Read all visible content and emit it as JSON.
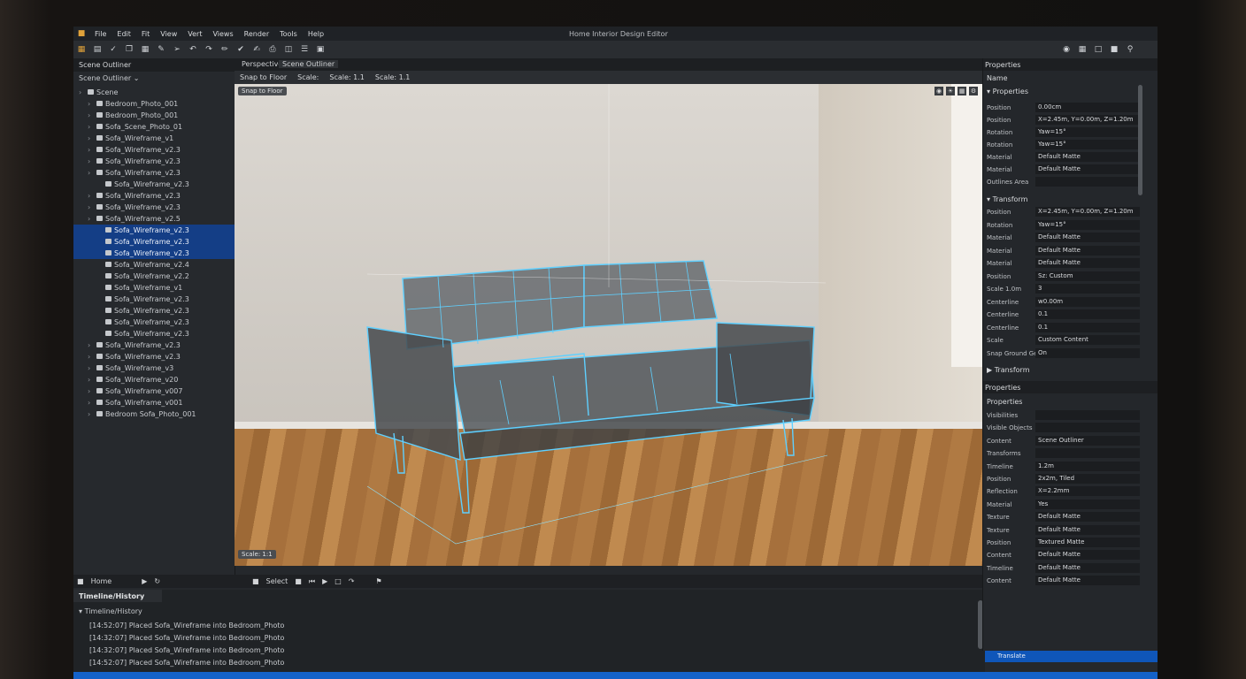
{
  "window": {
    "title": "Home Interior Design Editor"
  },
  "menubar": [
    "File",
    "Edit",
    "Fit",
    "View",
    "Vert",
    "Views",
    "Render",
    "Tools",
    "Help"
  ],
  "outliner": {
    "tab": "Scene Outliner",
    "header": "Scene Outliner",
    "items": [
      {
        "label": "Scene",
        "sel": false,
        "indent": 0
      },
      {
        "label": "Bedroom_Photo_001",
        "sel": false,
        "indent": 1
      },
      {
        "label": "Bedroom_Photo_001",
        "sel": false,
        "indent": 1
      },
      {
        "label": "Sofa_Scene_Photo_01",
        "sel": false,
        "indent": 1
      },
      {
        "label": "Sofa_Wireframe_v1",
        "sel": false,
        "indent": 1
      },
      {
        "label": "Sofa_Wireframe_v2.3",
        "sel": false,
        "indent": 1
      },
      {
        "label": "Sofa_Wireframe_v2.3",
        "sel": false,
        "indent": 1
      },
      {
        "label": "Sofa_Wireframe_v2.3",
        "sel": false,
        "indent": 1
      },
      {
        "label": "Sofa_Wireframe_v2.3",
        "sel": false,
        "indent": 2
      },
      {
        "label": "Sofa_Wireframe_v2.3",
        "sel": false,
        "indent": 1
      },
      {
        "label": "Sofa_Wireframe_v2.3",
        "sel": false,
        "indent": 1
      },
      {
        "label": "Sofa_Wireframe_v2.5",
        "sel": false,
        "indent": 1
      },
      {
        "label": "Sofa_Wireframe_v2.3",
        "sel": true,
        "indent": 2
      },
      {
        "label": "Sofa_Wireframe_v2.3",
        "sel": true,
        "indent": 2
      },
      {
        "label": "Sofa_Wireframe_v2.3",
        "sel": true,
        "indent": 2
      },
      {
        "label": "Sofa_Wireframe_v2.4",
        "sel": false,
        "indent": 2
      },
      {
        "label": "Sofa_Wireframe_v2.2",
        "sel": false,
        "indent": 2
      },
      {
        "label": "Sofa_Wireframe_v1",
        "sel": false,
        "indent": 2
      },
      {
        "label": "Sofa_Wireframe_v2.3",
        "sel": false,
        "indent": 2
      },
      {
        "label": "Sofa_Wireframe_v2.3",
        "sel": false,
        "indent": 2
      },
      {
        "label": "Sofa_Wireframe_v2.3",
        "sel": false,
        "indent": 2
      },
      {
        "label": "Sofa_Wireframe_v2.3",
        "sel": false,
        "indent": 2
      },
      {
        "label": "Sofa_Wireframe_v2.3",
        "sel": false,
        "indent": 1
      },
      {
        "label": "Sofa_Wireframe_v2.3",
        "sel": false,
        "indent": 1
      },
      {
        "label": "Sofa_Wireframe_v3",
        "sel": false,
        "indent": 1
      },
      {
        "label": "Sofa_Wireframe_v20",
        "sel": false,
        "indent": 1
      },
      {
        "label": "Sofa_Wireframe_v007",
        "sel": false,
        "indent": 1
      },
      {
        "label": "Sofa_Wireframe_v001",
        "sel": false,
        "indent": 1
      },
      {
        "label": "Bedroom Sofa_Photo_001",
        "sel": false,
        "indent": 1
      }
    ]
  },
  "viewport": {
    "tabs": [
      "Perspective",
      "Scene Outliner"
    ],
    "bar": [
      "Snap to Floor",
      "Scale:",
      "Scale: 1.1",
      "Scale: 1.1"
    ],
    "chip_top": "Snap to Floor",
    "chip_bottom": "Scale: 1:1"
  },
  "bottom_strip": {
    "left": "Home",
    "mid": "Select"
  },
  "timeline": {
    "tab": "Timeline/History",
    "header": "Timeline/History",
    "lines": [
      "[14:52:07] Placed Sofa_Wireframe into Bedroom_Photo",
      "[14:32:07] Placed Sofa_Wireframe into Bedroom_Photo",
      "[14:32:07] Placed Sofa_Wireframe into Bedroom_Photo",
      "[14:52:07] Placed Sofa_Wireframe into Bedroom_Photo"
    ]
  },
  "properties": {
    "tab": "Properties",
    "toolbar": "Name",
    "section1": "Properties",
    "fields1": [
      {
        "k": "Position",
        "v": "0.00cm"
      },
      {
        "k": "Position",
        "v": "X=2.45m, Y=0.00m, Z=1.20m"
      },
      {
        "k": "Rotation",
        "v": "Yaw=15°"
      },
      {
        "k": "Rotation",
        "v": "Yaw=15°"
      },
      {
        "k": "Material",
        "v": "Default Matte"
      },
      {
        "k": "Material",
        "v": "Default Matte"
      },
      {
        "k": "Outlines Area",
        "v": ""
      }
    ],
    "section2": "Transform",
    "fields2": [
      {
        "k": "Position",
        "v": "X=2.45m, Y=0.00m, Z=1.20m"
      },
      {
        "k": "Rotation",
        "v": "Yaw=15°"
      },
      {
        "k": "Material",
        "v": "Default Matte"
      },
      {
        "k": "Material",
        "v": "Default Matte"
      },
      {
        "k": "Material",
        "v": "Default Matte"
      },
      {
        "k": "Position",
        "v": "Sz: Custom"
      },
      {
        "k": "Scale 1.0m",
        "v": "3"
      },
      {
        "k": "Centerline",
        "v": "w0.00m"
      },
      {
        "k": "Centerline",
        "v": "0.1"
      },
      {
        "k": "Centerline",
        "v": "0.1"
      },
      {
        "k": "Scale",
        "v": "Custom Content"
      },
      {
        "k": "Snap Ground Geo",
        "v": "On"
      }
    ],
    "subhead": "Transform",
    "panel2_tab": "Properties",
    "section3": "Properties",
    "fields3": [
      {
        "k": "Visibilities",
        "v": ""
      },
      {
        "k": "Visible Objects",
        "v": ""
      },
      {
        "k": "Content",
        "v": "Scene Outliner"
      },
      {
        "k": "Transforms",
        "v": ""
      },
      {
        "k": "Timeline",
        "v": "1.2m"
      },
      {
        "k": "Position",
        "v": "2x2m, Tiled"
      },
      {
        "k": "Reflection",
        "v": "X=2.2mm"
      },
      {
        "k": "Material",
        "v": "Yes"
      },
      {
        "k": "Texture",
        "v": "Default Matte"
      },
      {
        "k": "Texture",
        "v": "Default Matte"
      },
      {
        "k": "Position",
        "v": "Textured Matte"
      },
      {
        "k": "Content",
        "v": "Default Matte"
      },
      {
        "k": "Timeline",
        "v": "Default Matte"
      },
      {
        "k": "Content",
        "v": "Default Matte"
      }
    ],
    "bluebar": "Translate"
  },
  "colors": {
    "selection": "#143e86",
    "wireframe": "#5fd0ff",
    "status": "#1462c9"
  }
}
